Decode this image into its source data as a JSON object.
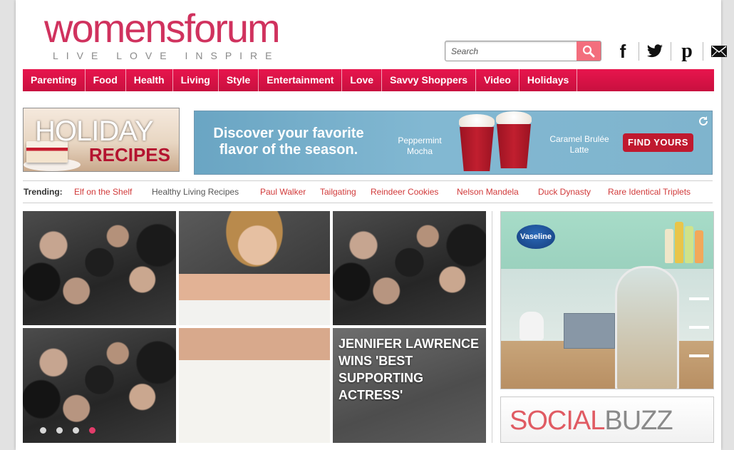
{
  "header": {
    "logo_main": "womensforum",
    "logo_tagline": "LIVE  LOVE  INSPIRE",
    "search_placeholder": "Search",
    "social": [
      {
        "name": "facebook-icon"
      },
      {
        "name": "twitter-icon"
      },
      {
        "name": "pinterest-icon"
      },
      {
        "name": "email-icon"
      }
    ]
  },
  "nav": {
    "items": [
      "Parenting",
      "Food",
      "Health",
      "Living",
      "Style",
      "Entertainment",
      "Love",
      "Savvy Shoppers",
      "Video",
      "Holidays"
    ]
  },
  "promo": {
    "line1": "HOLIDAY",
    "line2": "RECIPES"
  },
  "ad_top": {
    "headline": "Discover your favorite flavor of the season.",
    "flavor1": "Peppermint Mocha",
    "flavor2": "Caramel Brulée Latte",
    "cta": "FIND YOURS"
  },
  "trending": {
    "label": "Trending:",
    "links": [
      "Elf on the Shelf",
      "Healthy Living Recipes",
      "Paul Walker",
      "Tailgating",
      "Reindeer Cookies",
      "Nelson Mandela",
      "Duck Dynasty",
      "Rare Identical Triplets"
    ]
  },
  "hero": {
    "caption": "JENNIFER LAWRENCE WINS 'BEST SUPPORTING ACTRESS'",
    "slides": 4,
    "active_slide": 4
  },
  "right_ads": {
    "vaseline_brand": "Vaseline",
    "socialbuzz_part1": "SOCIAL",
    "socialbuzz_part2": "BUZZ"
  },
  "colors": {
    "brand_pink": "#d0325e",
    "nav_red": "#e0144a",
    "trending_link": "#d13a3a",
    "search_button": "#f36e7d"
  }
}
